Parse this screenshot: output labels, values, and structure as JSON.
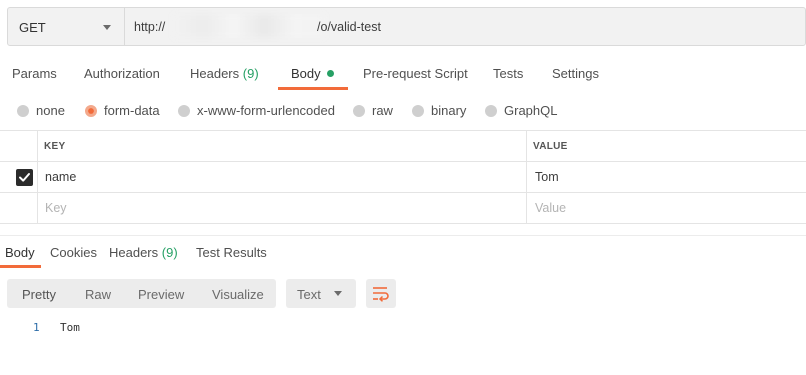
{
  "request": {
    "method": "GET",
    "url_prefix": "http://",
    "url_suffix": "/o/valid-test"
  },
  "request_tabs": {
    "params": "Params",
    "authorization": "Authorization",
    "headers": "Headers",
    "headers_count": "(9)",
    "body": "Body",
    "prerequest": "Pre-request Script",
    "tests": "Tests",
    "settings": "Settings",
    "active": "Body"
  },
  "body_types": {
    "none": "none",
    "form_data": "form-data",
    "urlencoded": "x-www-form-urlencoded",
    "raw": "raw",
    "binary": "binary",
    "graphql": "GraphQL",
    "selected": "form-data"
  },
  "form_table": {
    "key_header": "KEY",
    "value_header": "VALUE",
    "rows": [
      {
        "checked": true,
        "key": "name",
        "value": "Tom"
      }
    ],
    "new_row": {
      "key_placeholder": "Key",
      "value_placeholder": "Value"
    }
  },
  "response_tabs": {
    "body": "Body",
    "cookies": "Cookies",
    "headers": "Headers",
    "headers_count": "(9)",
    "test_results": "Test Results",
    "active": "Body"
  },
  "response_toolbar": {
    "pretty": "Pretty",
    "raw": "Raw",
    "preview": "Preview",
    "visualize": "Visualize",
    "format": "Text",
    "wrap_icon": "wrap-lines-icon"
  },
  "response_body": {
    "lines": [
      {
        "number": "1",
        "text": "Tom"
      }
    ]
  },
  "colors": {
    "accent": "#f26b3a",
    "success": "#26a065",
    "line_number": "#2d6da8"
  }
}
